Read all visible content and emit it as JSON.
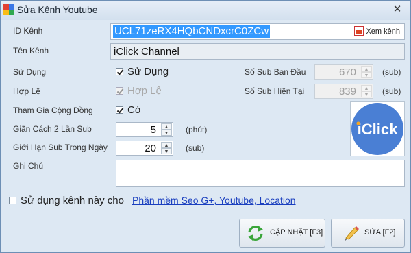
{
  "window": {
    "title": "Sửa Kênh Youtube"
  },
  "colors": {
    "link": "#1a3fbf",
    "selection": "#3399ff",
    "logo_circle": "#4a7fd4"
  },
  "fields": {
    "id_label": "ID Kênh",
    "id_value": "UCL71zeRX4HQbCNDxcrC0ZCw",
    "view_channel_label": "Xem kênh",
    "name_label": "Tên Kênh",
    "name_value": "iClick Channel",
    "use_label": "Sử Dụng",
    "use_check_label": "Sử Dụng",
    "valid_label": "Hợp Lệ",
    "valid_check_label": "Hợp Lệ",
    "community_label": "Tham Gia Cộng Đồng",
    "community_check_label": "Có",
    "interval_label": "Giãn Cách 2 Lần Sub",
    "interval_value": "5",
    "interval_unit": "(phút)",
    "daily_limit_label": "Giới Hạn Sub Trong Ngày",
    "daily_limit_value": "20",
    "daily_limit_unit": "(sub)",
    "initial_sub_label": "Số Sub Ban Đầu",
    "initial_sub_value": "670",
    "initial_sub_unit": "(sub)",
    "current_sub_label": "Số Sub Hiện Tại",
    "current_sub_value": "839",
    "current_sub_unit": "(sub)",
    "note_label": "Ghi Chú",
    "note_value": ""
  },
  "logo": {
    "text": "iClick"
  },
  "footer": {
    "use_channel_label": "Sử dụng kênh này cho",
    "software_link": "Phần mềm Seo G+, Youtube, Location"
  },
  "buttons": {
    "update_label": "CẬP NHẬT [F3]",
    "edit_label": "SỬA [F2]"
  },
  "icons": [
    "app-icon",
    "close-icon",
    "youtube-icon",
    "refresh-icon",
    "pencil-icon"
  ]
}
